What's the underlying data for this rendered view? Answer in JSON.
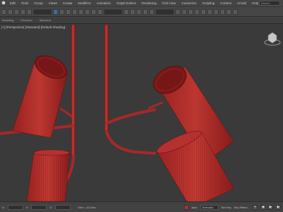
{
  "menu": {
    "items": [
      "Edit",
      "Tools",
      "Group",
      "Views",
      "Create",
      "Modifiers",
      "Animation",
      "Graph Editors",
      "Rendering",
      "Civil View",
      "Customize",
      "Scripting",
      "Content",
      "Arnold",
      "Help"
    ],
    "search_placeholder": "Search"
  },
  "ribbon": {
    "tabs": [
      "Modeling",
      "Freeform",
      "Selection"
    ]
  },
  "viewport": {
    "label": "[+] [Perspective] [Standard] [Default Shading]"
  },
  "status": {
    "coords": [
      "X:",
      "Y:",
      "Z:"
    ],
    "grid": "Grid = 10,0cm",
    "autokey": "Auto",
    "selected": "Selected",
    "setkey": "Set Key",
    "filters": "Key Filters..."
  },
  "colors": {
    "lamp": "#b52a2a",
    "lamp_dark": "#7a1616",
    "background": "#3a3a3a"
  }
}
